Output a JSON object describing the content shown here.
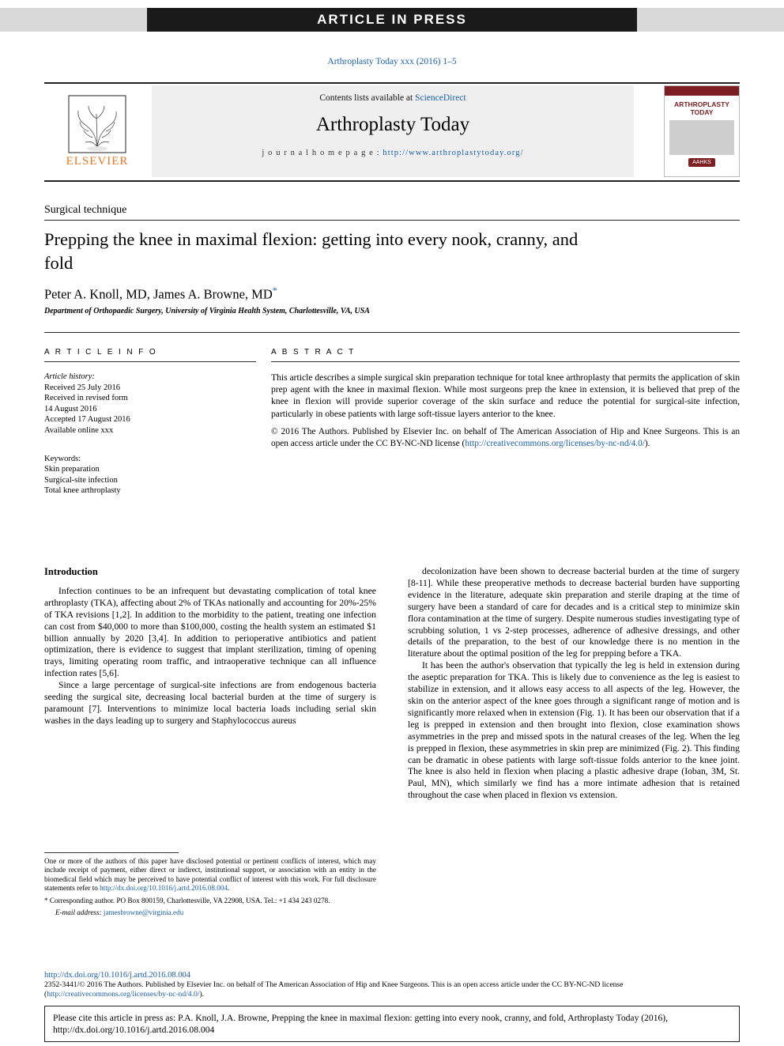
{
  "banner": {
    "label": "ARTICLE IN PRESS"
  },
  "journal_ref": "Arthroplasty Today xxx (2016) 1–5",
  "masthead": {
    "contents_prefix": "Contents lists available at ",
    "contents_link": "ScienceDirect",
    "journal_title": "Arthroplasty Today",
    "homepage_prefix": "j o u r n a l   h o m e p a g e :  ",
    "homepage_link": "http://www.arthroplastytoday.org/",
    "publisher": "ELSEVIER",
    "cover": {
      "title_line1": "ARTHROPLASTY",
      "title_line2": "TODAY",
      "society": "AAHKS"
    }
  },
  "article": {
    "kicker": "Surgical technique",
    "title": "Prepping the knee in maximal flexion: getting into every nook, cranny, and fold",
    "authors": "Peter A. Knoll, MD, James A. Browne, MD",
    "corresponding_mark": "*",
    "affiliation": "Department of Orthopaedic Surgery, University of Virginia Health System, Charlottesville, VA, USA"
  },
  "info": {
    "heading": "A R T I C L E   I N F O",
    "history_label": "Article history:",
    "history": [
      "Received 25 July 2016",
      "Received in revised form",
      "14 August 2016",
      "Accepted 17 August 2016",
      "Available online xxx"
    ],
    "keywords_label": "Keywords:",
    "keywords": [
      "Skin preparation",
      "Surgical-site infection",
      "Total knee arthroplasty"
    ]
  },
  "abstract": {
    "heading": "A B S T R A C T",
    "text": "This article describes a simple surgical skin preparation technique for total knee arthroplasty that permits the application of skin prep agent with the knee in maximal flexion. While most surgeons prep the knee in extension, it is believed that prep of the knee in flexion will provide superior coverage of the skin surface and reduce the potential for surgical-site infection, particularly in obese patients with large soft-tissue layers anterior to the knee.",
    "copyright": "© 2016 The Authors. Published by Elsevier Inc. on behalf of The American Association of Hip and Knee Surgeons. This is an open access article under the CC BY-NC-ND license (",
    "copyright_link": "http://creativecommons.org/licenses/by-nc-nd/4.0/",
    "copyright_tail": ")."
  },
  "body": {
    "intro_heading": "Introduction",
    "left_p1": "Infection continues to be an infrequent but devastating complication of total knee arthroplasty (TKA), affecting about 2% of TKAs nationally and accounting for 20%-25% of TKA revisions [1,2]. In addition to the morbidity to the patient, treating one infection can cost from $40,000 to more than $100,000, costing the health system an estimated $1 billion annually by 2020 [3,4]. In addition to perioperative antibiotics and patient optimization, there is evidence to suggest that implant sterilization, timing of opening trays, limiting operating room traffic, and intraoperative technique can all influence infection rates [5,6].",
    "left_p2": "Since a large percentage of surgical-site infections are from endogenous bacteria seeding the surgical site, decreasing local bacterial burden at the time of surgery is paramount [7]. Interventions to minimize local bacteria loads including serial skin washes in the days leading up to surgery and Staphylococcus aureus",
    "right_p1": "decolonization have been shown to decrease bacterial burden at the time of surgery [8-11]. While these preoperative methods to decrease bacterial burden have supporting evidence in the literature, adequate skin preparation and sterile draping at the time of surgery have been a standard of care for decades and is a critical step to minimize skin flora contamination at the time of surgery. Despite numerous studies investigating type of scrubbing solution, 1 vs 2-step processes, adherence of adhesive dressings, and other details of the preparation, to the best of our knowledge there is no mention in the literature about the optimal position of the leg for prepping before a TKA.",
    "right_p2": "It has been the author's observation that typically the leg is held in extension during the aseptic preparation for TKA. This is likely due to convenience as the leg is easiest to stabilize in extension, and it allows easy access to all aspects of the leg. However, the skin on the anterior aspect of the knee goes through a significant range of motion and is significantly more relaxed when in extension (Fig. 1). It has been our observation that if a leg is prepped in extension and then brought into flexion, close examination shows asymmetries in the prep and missed spots in the natural creases of the leg. When the leg is prepped in flexion, these asymmetries in skin prep are minimized (Fig. 2). This finding can be dramatic in obese patients with large soft-tissue folds anterior to the knee joint. The knee is also held in flexion when placing a plastic adhesive drape (Ioban, 3M, St. Paul, MN), which similarly we find has a more intimate adhesion that is retained throughout the case when placed in flexion vs extension."
  },
  "footnotes": {
    "disclosure": "One or more of the authors of this paper have disclosed potential or pertinent conflicts of interest, which may include receipt of payment, either direct or indirect, institutional support, or association with an entity in the biomedical field which may be perceived to have potential conflict of interest with this work. For full disclosure statements refer to ",
    "disclosure_link": "http://dx.doi.org/10.1016/j.artd.2016.08.004",
    "disclosure_tail": ".",
    "corresponding": "* Corresponding author. PO Box 800159, Charlottesville, VA 22908, USA. Tel.: +1 434 243 0278.",
    "email_label": "E-mail address:",
    "email": "jamesbrowne@virginia.edu"
  },
  "footer": {
    "doi": "http://dx.doi.org/10.1016/j.artd.2016.08.004",
    "issn_line": "2352-3441/© 2016 The Authors. Published by Elsevier Inc. on behalf of The American Association of Hip and Knee Surgeons. This is an open access article under the CC BY-NC-ND license (",
    "issn_link": "http://creativecommons.org/licenses/by-nc-nd/4.0/",
    "issn_tail": ").",
    "citation": "Please cite this article in press as: P.A. Knoll, J.A. Browne, Prepping the knee in maximal flexion: getting into every nook, cranny, and fold, Arthroplasty Today (2016), http://dx.doi.org/10.1016/j.artd.2016.08.004"
  }
}
